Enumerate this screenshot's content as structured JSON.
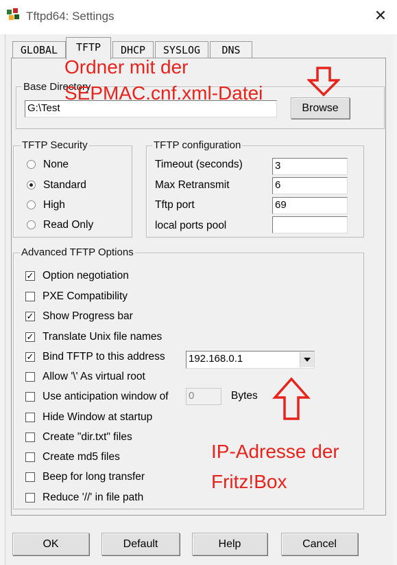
{
  "window": {
    "title": "Tftpd64: Settings",
    "close_glyph": "✕"
  },
  "tabs": [
    {
      "label": "GLOBAL"
    },
    {
      "label": "TFTP"
    },
    {
      "label": "DHCP"
    },
    {
      "label": "SYSLOG"
    },
    {
      "label": "DNS"
    }
  ],
  "base_directory": {
    "label": "Base Directory",
    "value": "G:\\Test",
    "browse_label": "Browse"
  },
  "security": {
    "label": "TFTP Security",
    "options": [
      "None",
      "Standard",
      "High",
      "Read Only"
    ],
    "selected": "Standard"
  },
  "config": {
    "label": "TFTP configuration",
    "fields": [
      {
        "label": "Timeout (seconds)",
        "value": "3"
      },
      {
        "label": "Max Retransmit",
        "value": "6"
      },
      {
        "label": "Tftp port",
        "value": "69"
      },
      {
        "label": "local ports pool",
        "value": ""
      }
    ]
  },
  "advanced": {
    "label": "Advanced TFTP Options",
    "options": [
      {
        "label": "Option negotiation",
        "checked": true
      },
      {
        "label": "PXE Compatibility",
        "checked": false
      },
      {
        "label": "Show Progress bar",
        "checked": true
      },
      {
        "label": "Translate Unix file names",
        "checked": true
      },
      {
        "label": "Bind TFTP to this address",
        "checked": true
      },
      {
        "label": "Allow '\\' As virtual root",
        "checked": false
      },
      {
        "label": "Use anticipation window of",
        "checked": false
      },
      {
        "label": "Hide Window at startup",
        "checked": false
      },
      {
        "label": "Create \"dir.txt\" files",
        "checked": false
      },
      {
        "label": "Create md5 files",
        "checked": false
      },
      {
        "label": "Beep for long transfer",
        "checked": false
      },
      {
        "label": "Reduce '//' in file path",
        "checked": false
      }
    ],
    "bind_address": "192.168.0.1",
    "anticipation_value": "0",
    "bytes_label": "Bytes"
  },
  "buttons": {
    "ok": "OK",
    "default": "Default",
    "help": "Help",
    "cancel": "Cancel"
  },
  "annotations": {
    "folder_note": [
      "Ordner mit der",
      "SEPMAC.cnf.xml-Datei"
    ],
    "ip_note": [
      "IP-Adresse der",
      "Fritz!Box"
    ]
  },
  "colors": {
    "annotation": "#e8231c",
    "window_bg": "#f0f0f0"
  }
}
